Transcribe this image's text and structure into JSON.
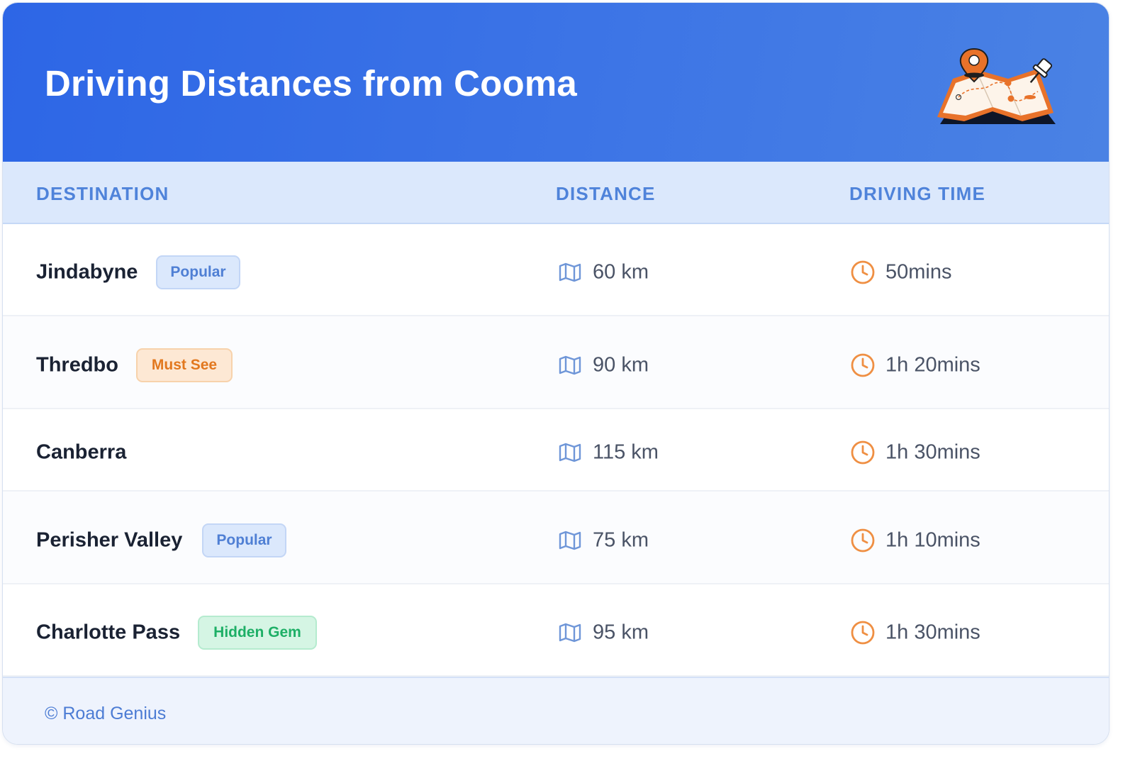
{
  "header": {
    "title": "Driving Distances from Cooma",
    "illustration_icon": "map-pin-illustration"
  },
  "table": {
    "columns": [
      "DESTINATION",
      "DISTANCE",
      "DRIVING TIME"
    ],
    "rows": [
      {
        "destination": "Jindabyne",
        "badge": "Popular",
        "badge_type": "popular",
        "distance": "60 km",
        "time": "50mins"
      },
      {
        "destination": "Thredbo",
        "badge": "Must See",
        "badge_type": "mustsee",
        "distance": "90 km",
        "time": "1h 20mins"
      },
      {
        "destination": "Canberra",
        "badge": "",
        "badge_type": "",
        "distance": "115 km",
        "time": "1h 30mins"
      },
      {
        "destination": "Perisher Valley",
        "badge": "Popular",
        "badge_type": "popular",
        "distance": "75 km",
        "time": "1h 10mins"
      },
      {
        "destination": "Charlotte Pass",
        "badge": "Hidden Gem",
        "badge_type": "gem",
        "distance": "95 km",
        "time": "1h 30mins"
      }
    ]
  },
  "footer": {
    "text": "© Road Genius"
  },
  "colors": {
    "header_gradient_start": "#2d66e6",
    "header_gradient_end": "#4a82e4",
    "column_header_text": "#4f83da",
    "distance_icon": "#6f96d8",
    "time_icon": "#ef8f43"
  }
}
